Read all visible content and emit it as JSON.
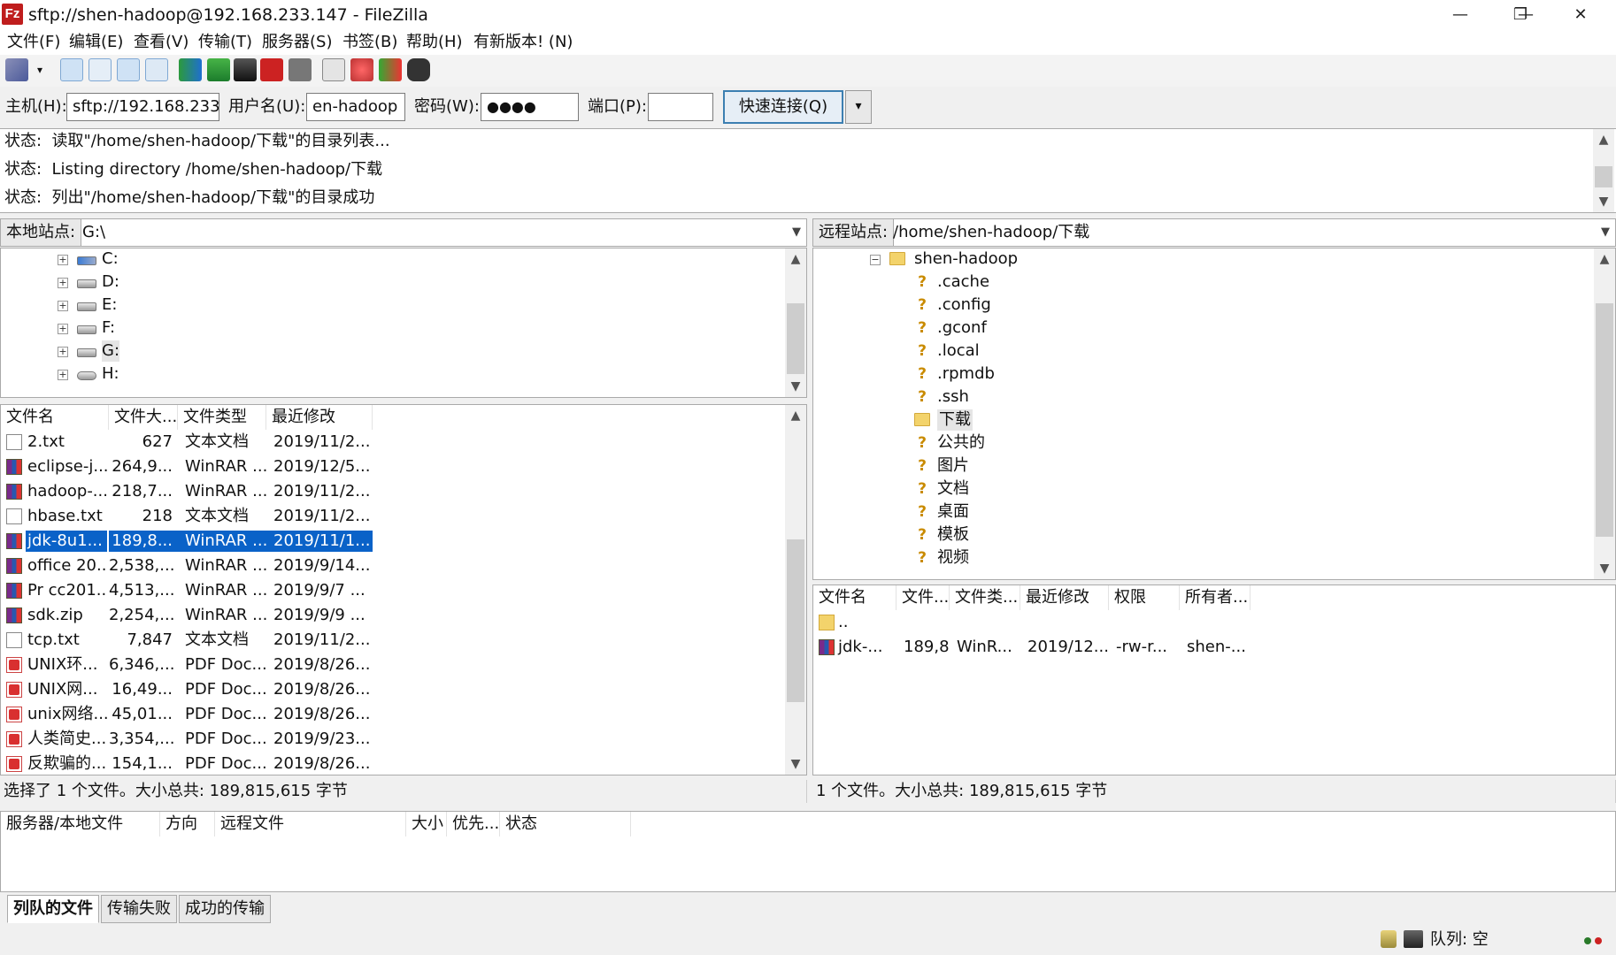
{
  "window": {
    "title": "sftp://shen-hadoop@192.168.233.147 - FileZilla",
    "app_icon": "Fz",
    "minimize_glyph": "—",
    "restore_glyph": "❐",
    "close_glyph": "✕"
  },
  "menu": [
    "文件(F)",
    "编辑(E)",
    "查看(V)",
    "传输(T)",
    "服务器(S)",
    "书签(B)",
    "帮助(H)",
    "有新版本! (N)"
  ],
  "toolbar_icons": [
    "site-manager-icon",
    "dropdown-arrow-icon",
    "toggle-log-icon",
    "toggle-local-tree-icon",
    "toggle-remote-tree-icon",
    "toggle-queue-icon",
    "refresh-icon",
    "process-queue-icon",
    "cancel-icon",
    "disconnect-icon",
    "reconnect-icon",
    "compare-icon",
    "sync-browse-icon",
    "filter-icon",
    "find-files-icon"
  ],
  "quickconnect": {
    "host_label": "主机(H):",
    "host_value": "sftp://192.168.233.",
    "user_label": "用户名(U):",
    "user_value": "en-hadoop",
    "pass_label": "密码(W):",
    "pass_value": "●●●●",
    "port_label": "端口(P):",
    "port_value": "",
    "connect_button": "快速连接(Q)",
    "dropdown_glyph": "▾"
  },
  "log": [
    {
      "label": "状态:",
      "text": "读取\"/home/shen-hadoop/下载\"的目录列表..."
    },
    {
      "label": "状态:",
      "text": "Listing directory /home/shen-hadoop/下载"
    },
    {
      "label": "状态:",
      "text": "列出\"/home/shen-hadoop/下载\"的目录成功"
    }
  ],
  "local": {
    "site_label": "本地站点:",
    "site_path": "G:\\",
    "drives": [
      "C:",
      "D:",
      "E:",
      "F:",
      "G:",
      "H:"
    ],
    "columns": [
      "文件名",
      "文件大...",
      "文件类型",
      "最近修改"
    ],
    "files": [
      {
        "icon": "txt",
        "name": "2.txt",
        "size": "627",
        "type": "文本文档",
        "modified": "2019/11/2..."
      },
      {
        "icon": "rar",
        "name": "eclipse-j...",
        "size": "264,9...",
        "type": "WinRAR ...",
        "modified": "2019/12/5..."
      },
      {
        "icon": "rar",
        "name": "hadoop-...",
        "size": "218,7...",
        "type": "WinRAR ...",
        "modified": "2019/11/2..."
      },
      {
        "icon": "txt",
        "name": "hbase.txt",
        "size": "218",
        "type": "文本文档",
        "modified": "2019/11/2..."
      },
      {
        "icon": "rar",
        "name": "jdk-8u1...",
        "size": "189,8...",
        "type": "WinRAR ...",
        "modified": "2019/11/1...",
        "selected": true
      },
      {
        "icon": "rar",
        "name": "office 20...",
        "size": "2,538,...",
        "type": "WinRAR ...",
        "modified": "2019/9/14..."
      },
      {
        "icon": "rar",
        "name": "Pr cc201...",
        "size": "4,513,...",
        "type": "WinRAR ...",
        "modified": "2019/9/7 ..."
      },
      {
        "icon": "rar",
        "name": "sdk.zip",
        "size": "2,254,...",
        "type": "WinRAR ...",
        "modified": "2019/9/9 ..."
      },
      {
        "icon": "txt",
        "name": "tcp.txt",
        "size": "7,847",
        "type": "文本文档",
        "modified": "2019/11/2..."
      },
      {
        "icon": "pdf",
        "name": "UNIX环...",
        "size": "6,346,...",
        "type": "PDF Doc...",
        "modified": "2019/8/26..."
      },
      {
        "icon": "pdf",
        "name": "UNIX网...",
        "size": "16,49...",
        "type": "PDF Doc...",
        "modified": "2019/8/26..."
      },
      {
        "icon": "pdf",
        "name": "unix网络...",
        "size": "45,01...",
        "type": "PDF Doc...",
        "modified": "2019/8/26..."
      },
      {
        "icon": "pdf",
        "name": "人类简史...",
        "size": "3,354,...",
        "type": "PDF Doc...",
        "modified": "2019/9/23..."
      },
      {
        "icon": "pdf",
        "name": "反欺骗的...",
        "size": "154,1...",
        "type": "PDF Doc...",
        "modified": "2019/8/26..."
      }
    ],
    "status": "选择了 1 个文件。大小总共: 189,815,615 字节"
  },
  "remote": {
    "site_label": "远程站点:",
    "site_path": "/home/shen-hadoop/下载",
    "root": "shen-hadoop",
    "tree": [
      {
        "name": ".cache",
        "icon": "unknown"
      },
      {
        "name": ".config",
        "icon": "unknown"
      },
      {
        "name": ".gconf",
        "icon": "unknown"
      },
      {
        "name": ".local",
        "icon": "unknown"
      },
      {
        "name": ".rpmdb",
        "icon": "unknown"
      },
      {
        "name": ".ssh",
        "icon": "unknown"
      },
      {
        "name": "下载",
        "icon": "folder"
      },
      {
        "name": "公共的",
        "icon": "unknown"
      },
      {
        "name": "图片",
        "icon": "unknown"
      },
      {
        "name": "文档",
        "icon": "unknown"
      },
      {
        "name": "桌面",
        "icon": "unknown"
      },
      {
        "name": "模板",
        "icon": "unknown"
      },
      {
        "name": "视频",
        "icon": "unknown"
      }
    ],
    "columns": [
      "文件名",
      "文件...",
      "文件类...",
      "最近修改",
      "权限",
      "所有者..."
    ],
    "files": [
      {
        "icon": "folder",
        "name": "..",
        "size": "",
        "type": "",
        "modified": "",
        "perms": "",
        "owner": ""
      },
      {
        "icon": "rar",
        "name": "jdk-...",
        "size": "189,8...",
        "type": "WinR...",
        "modified": "2019/12...",
        "perms": "-rw-r...",
        "owner": "shen-..."
      }
    ],
    "status": "1 个文件。大小总共: 189,815,615 字节"
  },
  "queue": {
    "columns": [
      "服务器/本地文件",
      "方向",
      "远程文件",
      "大小",
      "优先...",
      "状态"
    ],
    "tabs": [
      "列队的文件",
      "传输失败",
      "成功的传输"
    ],
    "status": "队列: 空"
  },
  "colors": {
    "selection": "#0a62c8",
    "accent_border": "#3c7fb1"
  }
}
